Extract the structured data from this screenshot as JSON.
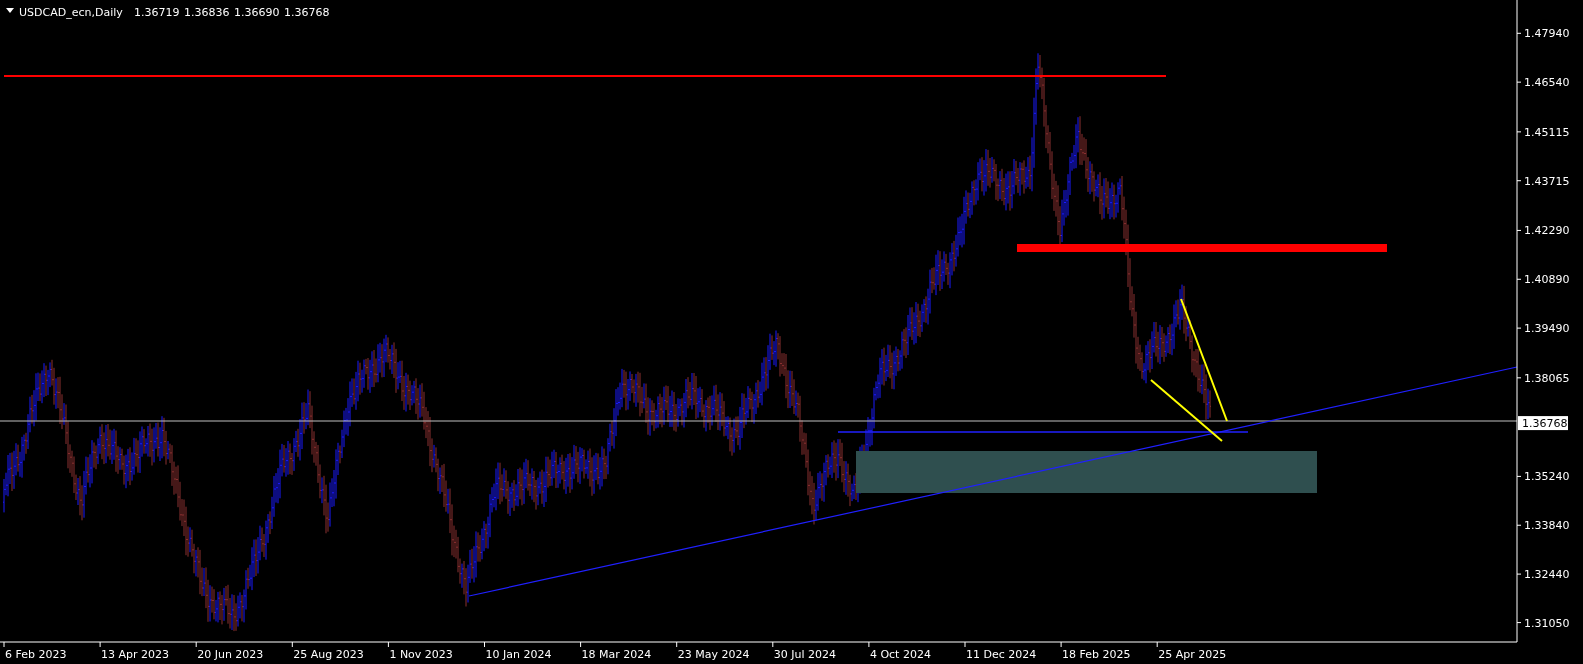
{
  "chart_header": {
    "symbol": "USDCAD_ecn,Daily",
    "quotes": [
      "1.36719",
      "1.36836",
      "1.36690",
      "1.36768"
    ]
  },
  "price_axis": {
    "labels": [
      "1.47940",
      "1.46540",
      "1.45115",
      "1.43715",
      "1.42290",
      "1.40890",
      "1.39490",
      "1.38065",
      "1.35240",
      "1.33840",
      "1.32440",
      "1.31050"
    ],
    "current_price": "1.36768"
  },
  "time_axis": {
    "labels": [
      "6 Feb 2023",
      "13 Apr 2023",
      "20 Jun 2023",
      "25 Aug 2023",
      "1 Nov 2023",
      "10 Jan 2024",
      "18 Mar 2024",
      "23 May 2024",
      "30 Jul 2024",
      "4 Oct 2024",
      "11 Dec 2024",
      "18 Feb 2025",
      "25 Apr 2025"
    ]
  }
}
